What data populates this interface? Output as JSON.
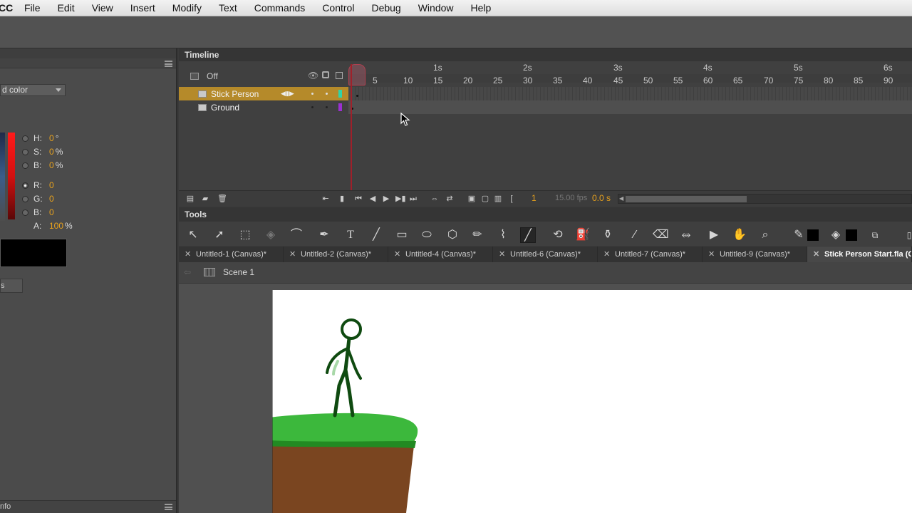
{
  "menubar": {
    "app_label": "CC",
    "items": [
      "File",
      "Edit",
      "View",
      "Insert",
      "Modify",
      "Text",
      "Commands",
      "Control",
      "Debug",
      "Window",
      "Help"
    ]
  },
  "color_panel": {
    "type_value": "d color",
    "hsb": [
      {
        "label": "H:",
        "value": "0",
        "unit": "°"
      },
      {
        "label": "S:",
        "value": "0",
        "unit": "%"
      },
      {
        "label": "B:",
        "value": "0",
        "unit": "%"
      }
    ],
    "rgb": [
      {
        "label": "R:",
        "value": "0",
        "unit": ""
      },
      {
        "label": "G:",
        "value": "0",
        "unit": ""
      },
      {
        "label": "B:",
        "value": "0",
        "unit": ""
      }
    ],
    "alpha": {
      "label": "A:",
      "value": "100",
      "unit": "%"
    },
    "swatch_color": "#000000",
    "small_button": "s",
    "bottom_label": "nfo"
  },
  "timeline": {
    "title": "Timeline",
    "header_label": "Off",
    "layers": [
      {
        "name": "Stick Person",
        "selected": true,
        "color": "#2fd3a8"
      },
      {
        "name": "Ground",
        "selected": false,
        "color": "#9b30d0"
      }
    ],
    "ruler_seconds": [
      "1s",
      "2s",
      "3s",
      "4s",
      "5s",
      "6s"
    ],
    "ruler_frames": [
      "5",
      "10",
      "15",
      "20",
      "25",
      "30",
      "35",
      "40",
      "45",
      "50",
      "55",
      "60",
      "65",
      "70",
      "75",
      "80",
      "85",
      "90"
    ],
    "current_frame": "1",
    "fps": "15.00 fps",
    "elapsed": "0.0 s"
  },
  "tools": {
    "title": "Tools",
    "items": [
      "selection-tool-icon",
      "subselection-tool-icon",
      "free-transform-icon",
      "3d-rotation-icon",
      "lasso-icon",
      "pen-icon",
      "text-tool-icon",
      "line-tool-icon",
      "rectangle-tool-icon",
      "oval-tool-icon",
      "polystar-icon",
      "pencil-icon",
      "paint-brush-icon",
      "brush-icon",
      "bone-icon",
      "paint-bucket-icon",
      "ink-bottle-icon",
      "eyedropper-icon",
      "eraser-icon",
      "width-tool-icon",
      "camera-icon",
      "hand-icon",
      "zoom-icon",
      "stroke-color-icon",
      "fill-color-icon",
      "swap-colors-icon",
      "options-icon"
    ],
    "glyph_text_tool": "T"
  },
  "doc_tabs": [
    {
      "label": "Untitled-1 (Canvas)*",
      "current": false
    },
    {
      "label": "Untitled-2 (Canvas)*",
      "current": false
    },
    {
      "label": "Untitled-4 (Canvas)*",
      "current": false
    },
    {
      "label": "Untitled-6 (Canvas)*",
      "current": false
    },
    {
      "label": "Untitled-7 (Canvas)*",
      "current": false
    },
    {
      "label": "Untitled-9 (Canvas)*",
      "current": false
    },
    {
      "label": "Stick Person Start.fla (C",
      "current": true
    }
  ],
  "doc_tab_close": "✕",
  "scene": {
    "label": "Scene 1"
  },
  "stage_colors": {
    "grass": "#3cb83c",
    "dirt": "#7a4520",
    "stick": "#0f4a10"
  }
}
